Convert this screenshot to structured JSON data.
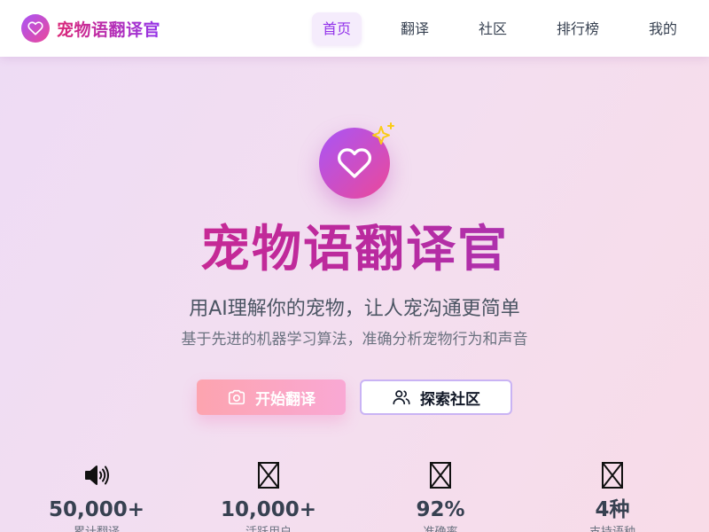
{
  "nav": {
    "brand": "宠物语翻译官",
    "items": [
      {
        "label": "首页",
        "active": true
      },
      {
        "label": "翻译",
        "active": false
      },
      {
        "label": "社区",
        "active": false
      },
      {
        "label": "排行榜",
        "active": false
      },
      {
        "label": "我的",
        "active": false
      }
    ]
  },
  "hero": {
    "title": "宠物语翻译官",
    "subtitle": "用AI理解你的宠物，让人宠沟通更简单",
    "description": "基于先进的机器学习算法，准确分析宠物行为和声音",
    "primary_button": "开始翻译",
    "secondary_button": "探索社区"
  },
  "stats": [
    {
      "icon": "speaker-icon",
      "value": "50,000+",
      "label": "累计翻译"
    },
    {
      "icon": "missing-glyph-icon",
      "value": "10,000+",
      "label": "活跃用户"
    },
    {
      "icon": "missing-glyph-icon",
      "value": "92%",
      "label": "准确率"
    },
    {
      "icon": "missing-glyph-icon",
      "value": "4种",
      "label": "支持语种"
    }
  ],
  "colors": {
    "brand_purple": "#a855f7",
    "brand_pink": "#ec4899",
    "title_gradient_start": "#d5288a",
    "title_gradient_end": "#9b3fc4",
    "primary_button": "#fda4af",
    "secondary_border": "#c9b3f4",
    "sparkle": "#facc15"
  }
}
